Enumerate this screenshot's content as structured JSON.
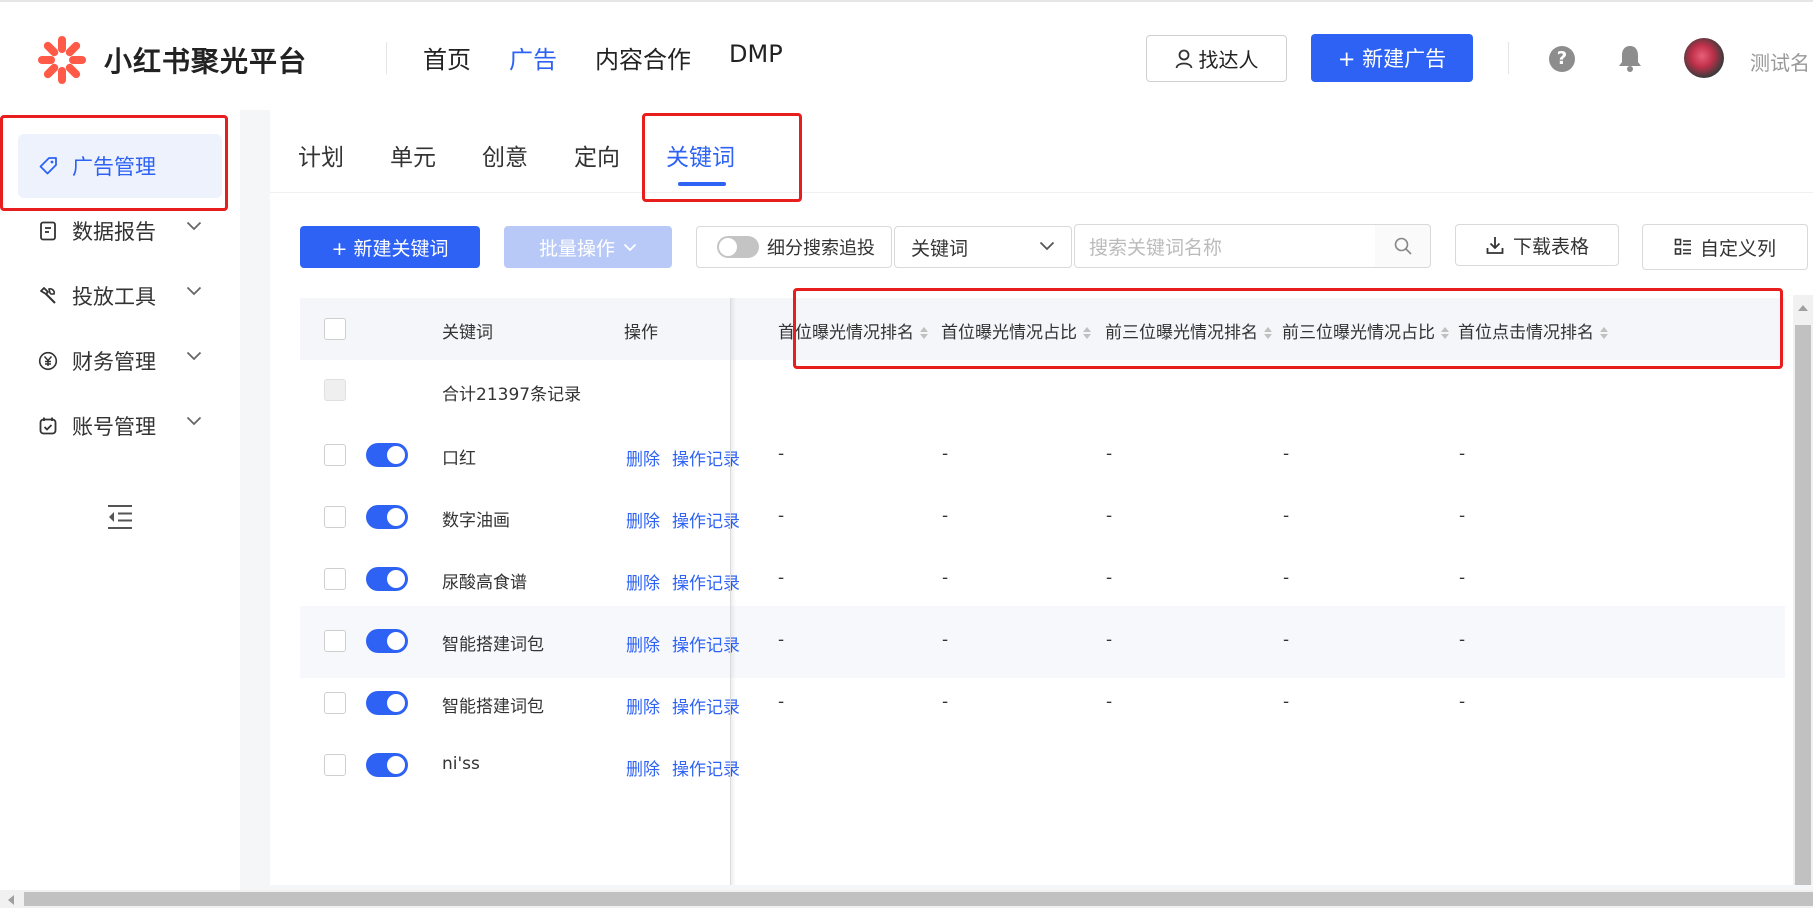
{
  "header": {
    "brand": "小红书聚光平台",
    "nav": [
      {
        "label": "首页",
        "active": false
      },
      {
        "label": "广告",
        "active": true
      },
      {
        "label": "内容合作",
        "active": false
      },
      {
        "label": "DMP",
        "active": false
      }
    ],
    "find_label": "找达人",
    "new_ad_label": "+ 新建广告",
    "help_glyph": "?",
    "username": "测试名"
  },
  "sidebar": {
    "items": [
      {
        "label": "广告管理",
        "icon": "tag-icon",
        "active": true
      },
      {
        "label": "数据报告",
        "icon": "report-icon"
      },
      {
        "label": "投放工具",
        "icon": "tools-icon"
      },
      {
        "label": "财务管理",
        "icon": "yen-icon"
      },
      {
        "label": "账号管理",
        "icon": "account-icon"
      }
    ]
  },
  "tabs": [
    "计划",
    "单元",
    "创意",
    "定向",
    "关键词"
  ],
  "active_tab": "关键词",
  "toolbar": {
    "new_keyword_label": "+ 新建关键词",
    "batch_label": "批量操作",
    "search_track_label": "细分搜索追投",
    "select_value": "关键词",
    "search_placeholder": "搜索关键词名称",
    "download_label": "下载表格",
    "custom_columns_label": "自定义列"
  },
  "table": {
    "columns": {
      "keyword": "关键词",
      "operation": "操作",
      "metrics": [
        "首位曝光情况排名",
        "首位曝光情况占比",
        "前三位曝光情况排名",
        "前三位曝光情况占比",
        "首位点击情况排名"
      ]
    },
    "summary": "合计21397条记录",
    "action_delete": "删除",
    "action_log": "操作记录",
    "rows": [
      {
        "keyword": "口红",
        "enabled": true,
        "metrics": [
          "-",
          "-",
          "-",
          "-",
          "-"
        ]
      },
      {
        "keyword": "数字油画",
        "enabled": true,
        "metrics": [
          "-",
          "-",
          "-",
          "-",
          "-"
        ]
      },
      {
        "keyword": "尿酸高食谱",
        "enabled": true,
        "metrics": [
          "-",
          "-",
          "-",
          "-",
          "-"
        ]
      },
      {
        "keyword": "智能搭建词包",
        "enabled": true,
        "metrics": [
          "-",
          "-",
          "-",
          "-",
          "-"
        ]
      },
      {
        "keyword": "智能搭建词包",
        "enabled": true,
        "metrics": [
          "-",
          "-",
          "-",
          "-",
          "-"
        ]
      },
      {
        "keyword": "ni'ss",
        "enabled": true,
        "metrics": [
          "",
          "",
          "",
          "",
          ""
        ]
      }
    ]
  },
  "colors": {
    "primary": "#2d62f5",
    "primary_disabled": "#b8c9f8",
    "highlight_box": "#e81e1e",
    "brand_logo": "#ff5a48"
  }
}
